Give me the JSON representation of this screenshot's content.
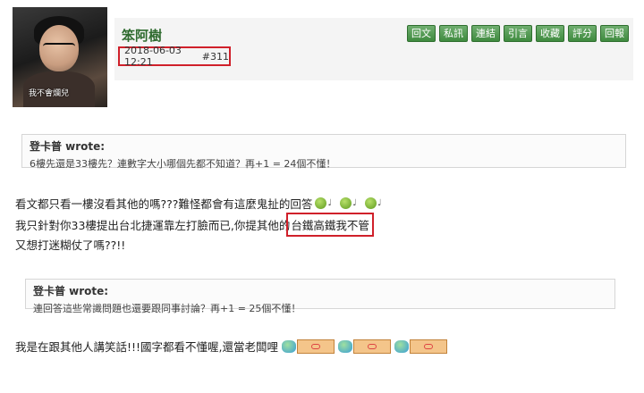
{
  "post": {
    "username": "笨阿樹",
    "timestamp": "2018-06-03 12:21",
    "post_number": "#311",
    "avatar_caption": "我不會爛兒"
  },
  "actions": [
    "回文",
    "私訊",
    "連結",
    "引言",
    "收藏",
    "評分",
    "回報"
  ],
  "quote1": {
    "author": "登卡普 wrote:",
    "text": "6樓先還是33樓先？連數字大小哪個先都不知道？再+1 = 24個不懂！"
  },
  "body": {
    "line1": "看文都只看一樓沒看其他的嗎???難怪都會有這麼鬼扯的回答",
    "line2_before": "我只針對你33樓提出台北捷運靠左打臉而已,你提其他的",
    "line2_highlight": "台鐵高鐵我不管",
    "line3": "又想打迷糊仗了嗎??!!"
  },
  "quote2": {
    "author": "登卡普 wrote:",
    "text": "連回答這些常識問題也還要跟同事討論？再+1 = 25個不懂！"
  },
  "line4": "我是在跟其他人講笑話!!!國字都看不懂喔,還當老闆哩",
  "icons": {
    "emoticon": "green-smiley-icon",
    "note": "music-note-icon",
    "banner": "emoji-banner-icon"
  },
  "colors": {
    "username": "#2f6b2f",
    "button": "#4f9a4f",
    "highlight_box": "#d0202a"
  }
}
